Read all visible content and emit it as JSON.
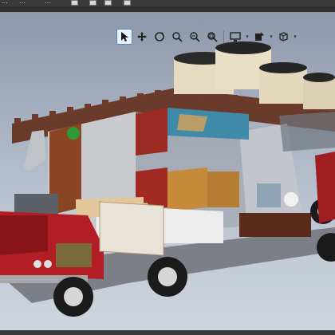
{
  "window": {
    "title": ""
  },
  "menu": {
    "fragments": [
      "...",
      "...",
      "..."
    ]
  },
  "viewport_toolbar": {
    "tools": [
      {
        "icon": "select-arrow-icon",
        "active": true
      },
      {
        "icon": "pan-icon",
        "active": false
      },
      {
        "icon": "orbit-icon",
        "active": false
      },
      {
        "icon": "zoom-window-icon",
        "active": false
      },
      {
        "icon": "zoom-icon",
        "active": false
      },
      {
        "icon": "zoom-extents-icon",
        "active": false
      },
      {
        "icon": "display-mode-icon",
        "active": false,
        "dropdown": true
      },
      {
        "icon": "render-style-icon",
        "active": false,
        "dropdown": true
      },
      {
        "icon": "view-cube-icon",
        "active": false,
        "dropdown": true
      }
    ],
    "dropdown_glyph": "▾"
  },
  "scene": {
    "description_icon": "3d-model-cutaway",
    "colors": {
      "background_top": "#8d98aa",
      "background_bottom": "#cfd6df",
      "truck_red": "#b11d24",
      "wood": "#7a3a1e",
      "tank": "#e8dcc0",
      "wall_white": "#e9e9e9"
    }
  }
}
